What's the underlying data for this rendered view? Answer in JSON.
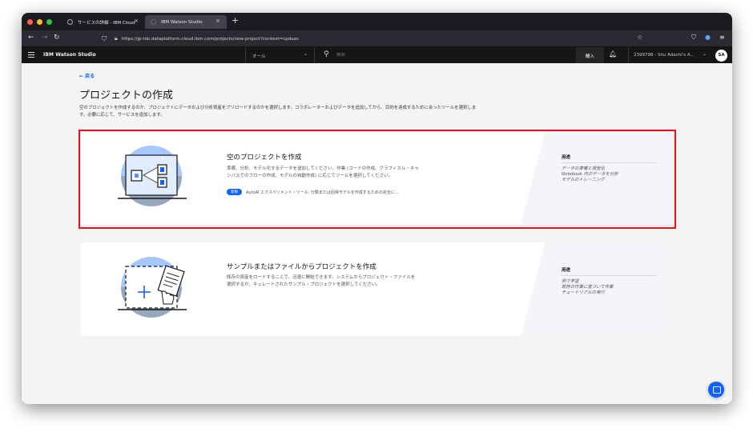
{
  "browser": {
    "tabs": [
      {
        "label": "サービスの詳細 - IBM Cloud",
        "close": "×"
      },
      {
        "label": "IBM Watson Studio",
        "close": "×"
      }
    ],
    "new_tab": "+",
    "nav": {
      "back": "←",
      "forward": "→",
      "reload": "↻"
    },
    "url": "https://jp-tok.dataplatform.cloud.ibm.com/projects/new-project?context=cpdaas",
    "icons": [
      "shield-icon",
      "lock-icon",
      "star-icon",
      "pocket-icon",
      "account-icon",
      "menu-icon"
    ]
  },
  "appbar": {
    "brand": "IBM Watson Studio",
    "scope": "オール",
    "search_placeholder": "検索",
    "buy": "購入",
    "account": "2399798 - Shu Adachi's A...",
    "avatar": "SA"
  },
  "page": {
    "back": "←  戻る",
    "title": "プロジェクトの作成",
    "desc": "空のプロジェクトを作成するのか、プロジェクトにデータおよび分析資産をプリロードするのかを選択します。コラボレーターおよびデータを追加してから、目的を達成するために合ったツールを選択します。必要に応じて、サービスを追加します。"
  },
  "cards": [
    {
      "title": "空のプロジェクトを作成",
      "desc": "準備、分析、モデル化するデータを追加してください。作業 (コードの作成、グラフィカル・キャンバスでのフローの作成、モデルの自動作成) に応じてツールを選択してください。",
      "tag": "新規",
      "tag_text": "AutoAI エクスペリメント・ツール: 分類または回帰モデルを作成するための完全に...",
      "usage_title": "用途",
      "usage": [
        "データの準備と視覚化",
        "Notebook 内のデータを分析",
        "モデルのトレーニング"
      ]
    },
    {
      "title": "サンプルまたはファイルからプロジェクトを作成",
      "desc": "既存の資産をロードすることで、迅速に開始できます。システムからプロジェクト・ファイルを選択するか、キュレートされたサンプル・プロジェクトを選択してください。",
      "usage_title": "用途",
      "usage": [
        "例で学習",
        "既存の作業に基づいて作業",
        "チュートリアルの実行"
      ]
    }
  ],
  "colors": {
    "accent": "#0f62fe",
    "highlight": "#e8111a",
    "appbar": "#161616"
  }
}
